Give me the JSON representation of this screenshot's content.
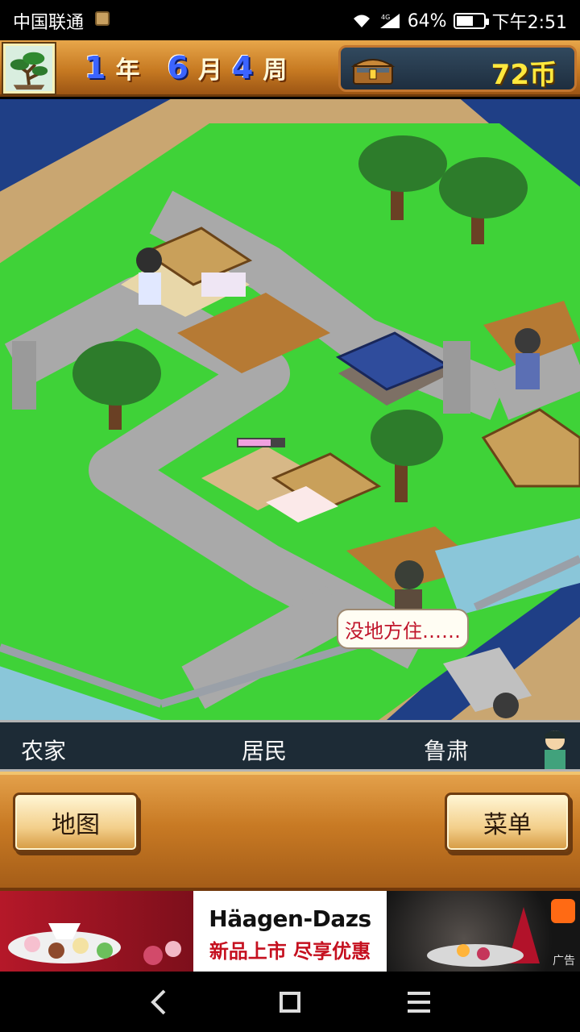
{
  "status_bar": {
    "carrier": "中国联通",
    "network": "4G",
    "battery_text": "64%",
    "battery_level": 0.64,
    "time": "下午2:51"
  },
  "top_bar": {
    "year_num": "1",
    "year_unit": "年",
    "month_num": "6",
    "month_unit": "月",
    "week_num": "4",
    "week_unit": "周",
    "coins": "72币",
    "bonsai_icon": "bonsai-tree-icon",
    "chest_icon": "treasure-chest-icon"
  },
  "map": {
    "speech_text": "没地方住……"
  },
  "info_bar": {
    "occupation": "农家",
    "type": "居民",
    "name": "鲁肃",
    "portrait_icon": "villager-portrait-icon"
  },
  "buttons": {
    "map_label": "地图",
    "menu_label": "菜单"
  },
  "ad": {
    "brand": "Häagen-Dazs",
    "slogan": "新品上市 尽享优惠",
    "tag": "广告"
  },
  "nav": {
    "back_icon": "back-icon",
    "home_icon": "home-icon",
    "recents_icon": "recents-icon"
  },
  "colors": {
    "accent_gold": "#ffe83d",
    "date_blue": "#3c64ff",
    "wood": "#c77a22",
    "grass": "#3fd238",
    "road": "#a9a9a9"
  }
}
